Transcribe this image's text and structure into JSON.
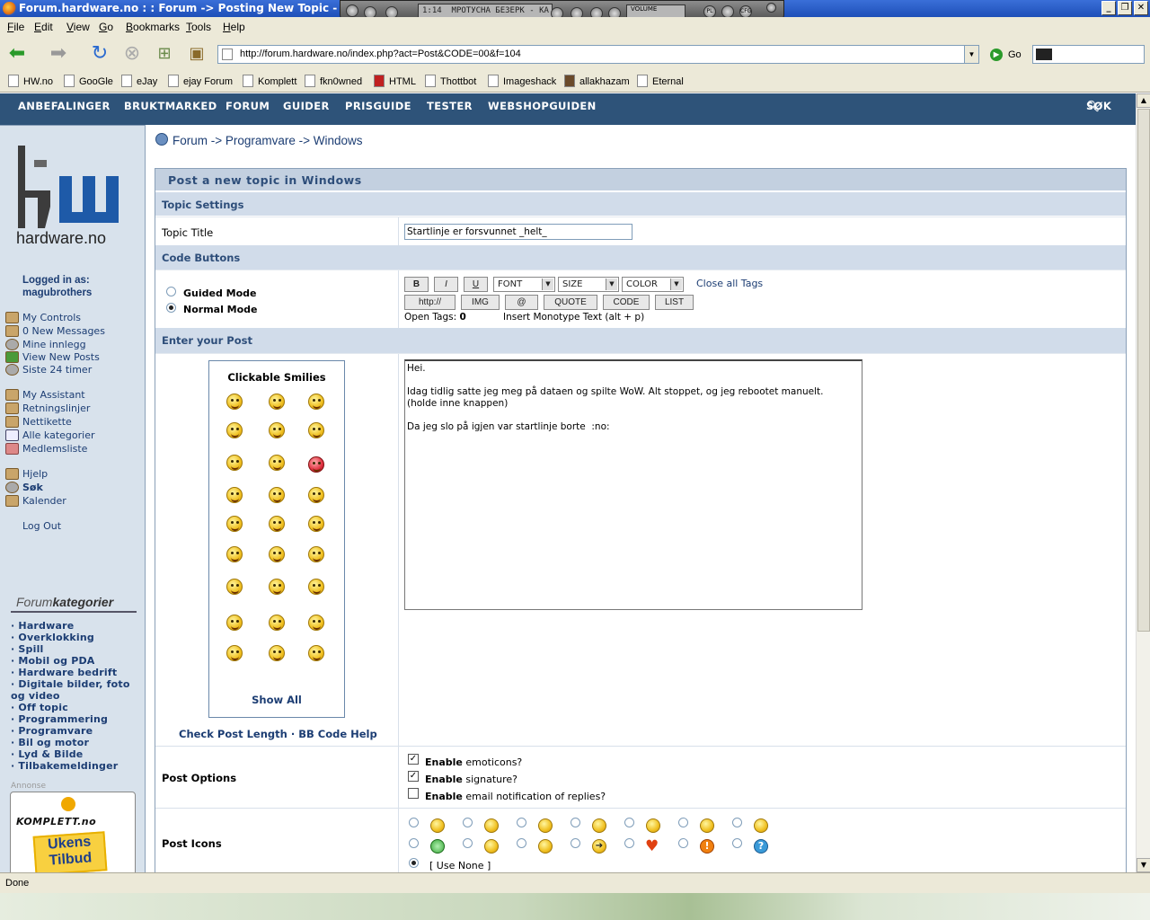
{
  "window": {
    "title": "Forum.hardware.no : : Forum -> Posting New Topic - Mozilla Fire"
  },
  "player": {
    "time": "1:14",
    "track": "МРОТУСНА БЕЗЕРК - КА",
    "volume_label": "VOLUME",
    "btn_pl": "PL",
    "btn_cfg": "CFG"
  },
  "menu": {
    "file": "File",
    "edit": "Edit",
    "view": "View",
    "go": "Go",
    "bookmarks": "Bookmarks",
    "tools": "Tools",
    "help": "Help"
  },
  "nav": {
    "url": "http://forum.hardware.no/index.php?act=Post&CODE=00&f=104",
    "go_label": "Go"
  },
  "bookmarks": [
    "HW.no",
    "GooGle",
    "eJay",
    "ejay Forum",
    "Komplett",
    "fkn0wned",
    "HTML",
    "Thottbot",
    "Imageshack",
    "allakhazam",
    "Eternal"
  ],
  "sitenav": {
    "items": [
      "ANBEFALINGER",
      "BRUKTMARKED",
      "FORUM",
      "GUIDER",
      "PRISGUIDE",
      "TESTER",
      "WEBSHOPGUIDEN"
    ],
    "search": "SØK"
  },
  "sidebar": {
    "logo_text": "hardware.no",
    "logged_in_label": "Logged in as:",
    "username": "magubrothers",
    "links1": [
      "My Controls",
      "0 New Messages",
      "Mine innlegg",
      "View New Posts",
      "Siste 24 timer"
    ],
    "links2": [
      "My Assistant",
      "Retningslinjer",
      "Nettikette",
      "Alle kategorier",
      "Medlemsliste"
    ],
    "links3": [
      "Hjelp",
      "Søk",
      "Kalender"
    ],
    "logout": "Log Out",
    "cat_title_a": "Forum",
    "cat_title_b": "kategorier",
    "categories": [
      "· Hardware",
      "· Overklokking",
      "· Spill",
      "· Mobil og PDA",
      "· Hardware bedrift",
      "· Digitale bilder, foto",
      "og video",
      "· Off topic",
      "· Programmering",
      "· Programvare",
      "· Bil og motor",
      "· Lyd & Bilde",
      "· Tilbakemeldinger"
    ],
    "ad_label": "Annonse",
    "ad_brand": "KOMPLETT.no",
    "ad_line1": "Ukens",
    "ad_line2": "Tilbud"
  },
  "breadcrumb": {
    "text": "Forum -> Programvare -> Windows"
  },
  "form": {
    "heading": "Post a new topic in Windows",
    "topic_settings": "Topic Settings",
    "topic_title_label": "Topic Title",
    "topic_title_value": "Startlinje er forsvunnet _helt_",
    "code_buttons": "Code Buttons",
    "guided_mode": "Guided Mode",
    "normal_mode": "Normal Mode",
    "btn_b": "B",
    "btn_i": "I",
    "btn_u": "U",
    "font": "FONT",
    "size": "SIZE",
    "color": "COLOR",
    "close_tags": "Close all Tags",
    "btn_http": "http://",
    "btn_img": "IMG",
    "btn_at": "@",
    "btn_quote": "QUOTE",
    "btn_code": "CODE",
    "btn_list": "LIST",
    "open_tags_label": "Open Tags:",
    "open_tags_count": "0",
    "insert_hint": "Insert Monotype Text (alt + p)",
    "enter_post": "Enter your Post",
    "smilies_title": "Clickable Smilies",
    "show_all": "Show All",
    "check_length": "Check Post Length",
    "sep": "·",
    "bbcode_help": "BB Code Help",
    "post_body": "Hei.\n\nIdag tidlig satte jeg meg på dataen og spilte WoW. Alt stoppet, og jeg rebootet manuelt.\n(holde inne knappen)\n\nDa jeg slo på igjen var startlinje borte  :no: ",
    "post_options": "Post Options",
    "enable": "Enable",
    "opt_emoticons": " emoticons?",
    "opt_signature": " signature?",
    "opt_email": " email notification of replies?",
    "emoticons_checked": true,
    "signature_checked": true,
    "email_checked": false,
    "post_icons": "Post Icons",
    "use_none": "[ Use None ]"
  },
  "status": {
    "text": "Done"
  },
  "colors": {
    "sitenav": "#2e5379",
    "header_bg": "#d1dcea",
    "link": "#1c3d73"
  }
}
